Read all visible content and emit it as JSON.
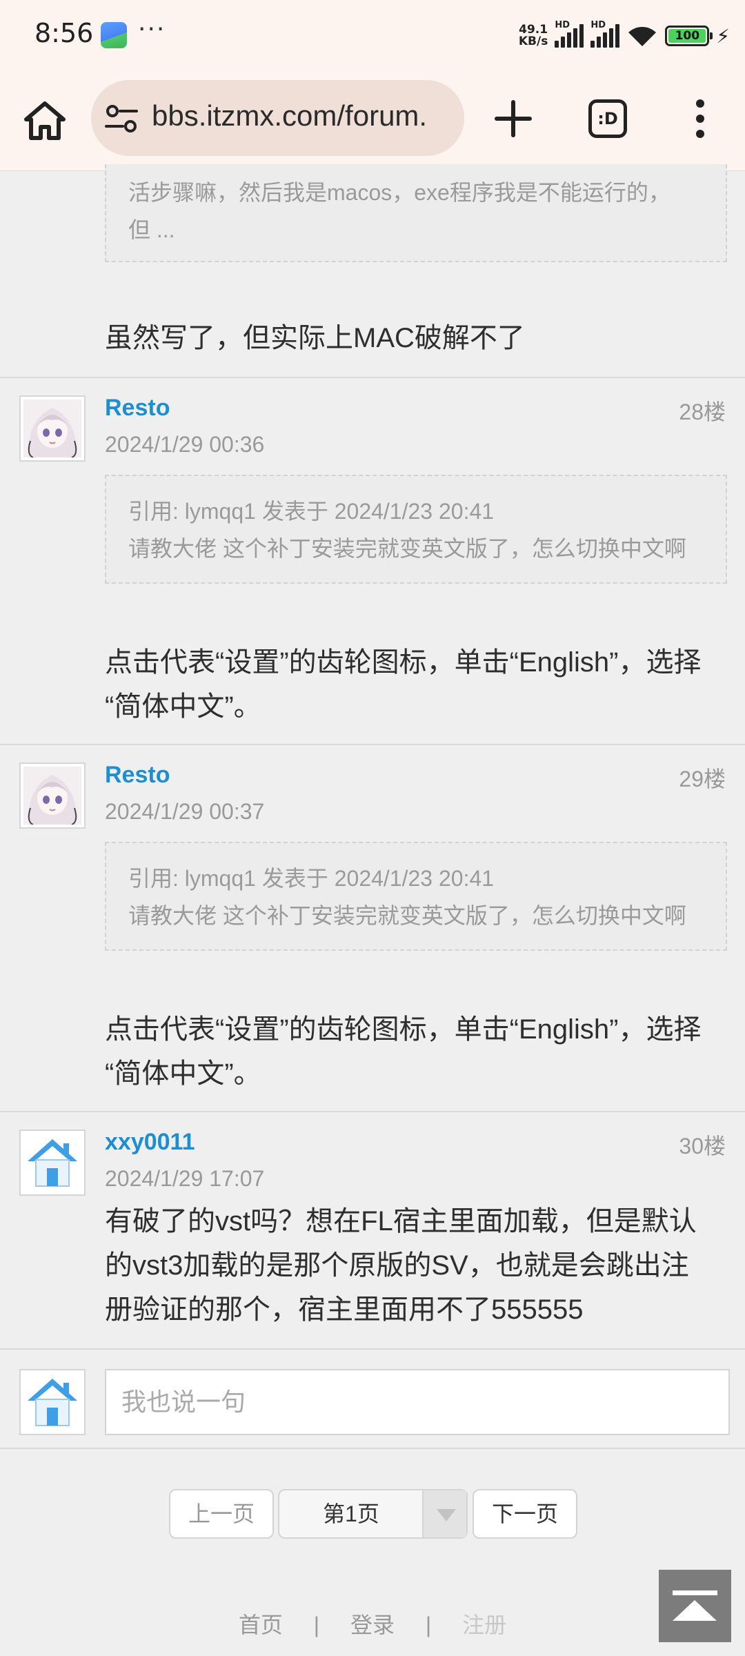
{
  "status_bar": {
    "time": "8:56",
    "more": "···",
    "net_speed_value": "49.1",
    "net_speed_unit": "KB/s",
    "hd": "HD",
    "battery": "100"
  },
  "browser": {
    "url": "bbs.itzmx.com/forum.",
    "tabs_label": ":D"
  },
  "thread": {
    "prev_quote": {
      "line1": "活步骤嘛，然后我是macos，exe程序我是不能运行的，",
      "line2": "但 ..."
    },
    "prev_post_text": "虽然写了，但实际上MAC破解不了",
    "posts": [
      {
        "username": "Resto",
        "floor": "28楼",
        "time": "2024/1/29 00:36",
        "quote_header": "引用: lymqq1 发表于 2024/1/23 20:41",
        "quote_body": "请教大佬 这个补丁安装完就变英文版了，怎么切换中文啊",
        "text_line1": "点击代表“设置”的齿轮图标，单击“English”，选择",
        "text_line2": "“简体中文”。"
      },
      {
        "username": "Resto",
        "floor": "29楼",
        "time": "2024/1/29 00:37",
        "quote_header": "引用: lymqq1 发表于 2024/1/23 20:41",
        "quote_body": "请教大佬 这个补丁安装完就变英文版了，怎么切换中文啊",
        "text_line1": "点击代表“设置”的齿轮图标，单击“English”，选择",
        "text_line2": "“简体中文”。"
      },
      {
        "username": "xxy0011",
        "floor": "30楼",
        "time": "2024/1/29 17:07",
        "text_line1": "有破了的vst吗？想在FL宿主里面加载，但是默认",
        "text_line2": "的vst3加载的是那个原版的SV，也就是会跳出注",
        "text_line3": "册验证的那个，宿主里面用不了555555"
      }
    ]
  },
  "reply": {
    "placeholder": "我也说一句"
  },
  "pagination": {
    "prev": "上一页",
    "current": "第1页",
    "next": "下一页"
  },
  "footer": {
    "home": "首页",
    "sep": "|",
    "login": "登录",
    "register": "注册"
  },
  "colors": {
    "username": "#1d8fd0",
    "browser_bar": "#fdf3ef",
    "url_box": "#efdfd7",
    "page_bg": "#efefef"
  }
}
